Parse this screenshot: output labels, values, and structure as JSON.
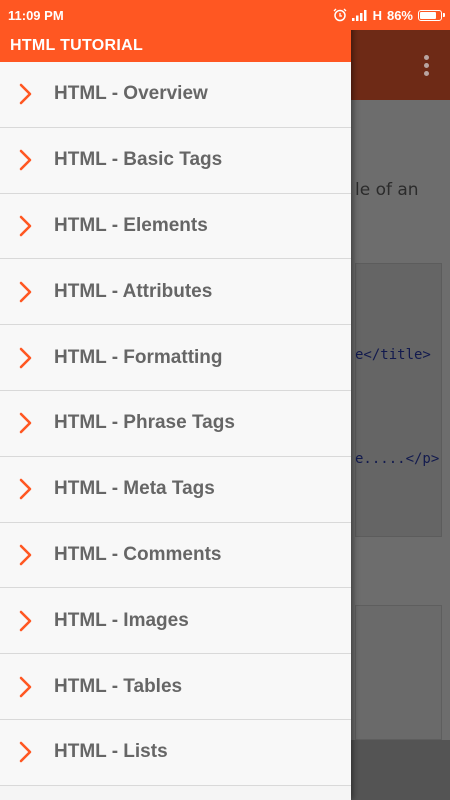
{
  "status_bar": {
    "time": "11:09 PM",
    "network": "H",
    "battery_text": "86%",
    "battery_level": 0.86
  },
  "drawer": {
    "title": "HTML TUTORIAL",
    "items": [
      {
        "label": "HTML - Overview"
      },
      {
        "label": "HTML - Basic Tags"
      },
      {
        "label": "HTML - Elements"
      },
      {
        "label": "HTML - Attributes"
      },
      {
        "label": "HTML - Formatting"
      },
      {
        "label": "HTML - Phrase Tags"
      },
      {
        "label": "HTML - Meta Tags"
      },
      {
        "label": "HTML - Comments"
      },
      {
        "label": "HTML - Images"
      },
      {
        "label": "HTML - Tables"
      },
      {
        "label": "HTML - Lists"
      }
    ]
  },
  "background": {
    "text_fragment": "le of an",
    "code_line_1": "e</title>",
    "code_line_2": "e.....</p>"
  },
  "colors": {
    "accent": "#ff5722",
    "chevron": "#ff5722",
    "item_text": "#666666"
  },
  "icons": {
    "chevron": "chevron-right-icon",
    "alarm": "alarm-icon",
    "signal": "signal-icon",
    "battery": "battery-icon",
    "overflow": "more-vert-icon"
  }
}
